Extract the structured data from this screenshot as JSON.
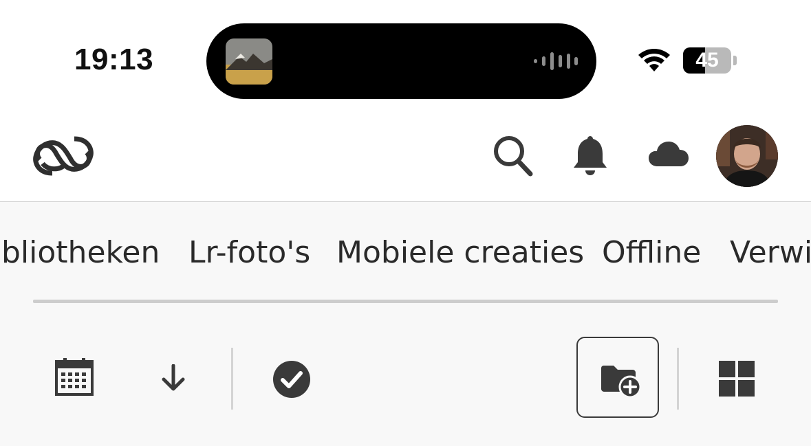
{
  "status_bar": {
    "time": "19:13",
    "battery_percent": "45",
    "battery_level": 0.45,
    "icons": [
      "now-playing-thumbnail",
      "audio-waveform-icon",
      "wifi-icon",
      "battery-icon"
    ]
  },
  "header": {
    "logo_icon": "creative-cloud-logo",
    "icons": [
      "search-icon",
      "bell-icon",
      "cloud-icon",
      "avatar"
    ]
  },
  "tabs": [
    {
      "label": "bliotheken"
    },
    {
      "label": "Lr-foto's"
    },
    {
      "label": "Mobiele creaties"
    },
    {
      "label": "Offline"
    },
    {
      "label": "Verwi"
    }
  ],
  "toolbar": {
    "icons": [
      "calendar-icon",
      "sort-down-arrow-icon",
      "select-check-icon",
      "new-folder-icon",
      "grid-view-icon"
    ]
  },
  "colors": {
    "background": "#f8f8f8",
    "icon": "#3a3a3a",
    "island": "#000000"
  }
}
